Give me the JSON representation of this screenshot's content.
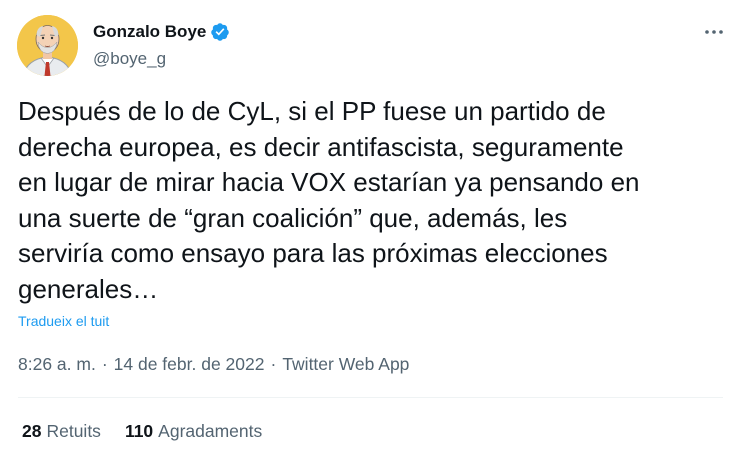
{
  "author": {
    "display_name": "Gonzalo Boye",
    "handle": "@boye_g",
    "verified": true,
    "avatar_icon": "cartoon-portrait-avatar"
  },
  "tweet": {
    "lines": [
      "Después de lo de CyL, si el PP fuese un partido de",
      "derecha europea, es decir antifascista, seguramente",
      "en lugar de mirar hacia VOX estarían ya pensando en",
      "una suerte de “gran coalición” que, además, les",
      "serviría como ensayo para las próximas elecciones",
      "generales…"
    ],
    "translate_label": "Tradueix el tuit",
    "time": "8:26 a. m.",
    "date": "14 de febr. de 2022",
    "source": "Twitter Web App",
    "separator": "·"
  },
  "stats": {
    "retweets_count": "28",
    "retweets_label": "Retuits",
    "likes_count": "110",
    "likes_label": "Agradaments"
  },
  "icons": {
    "verified": "verified-badge-icon",
    "more": "more-options-icon"
  },
  "colors": {
    "accent": "#1d9bf0",
    "text_primary": "#0f1419",
    "text_secondary": "#536471",
    "divider": "#eff3f4",
    "avatar_bg": "#f3c64a"
  }
}
